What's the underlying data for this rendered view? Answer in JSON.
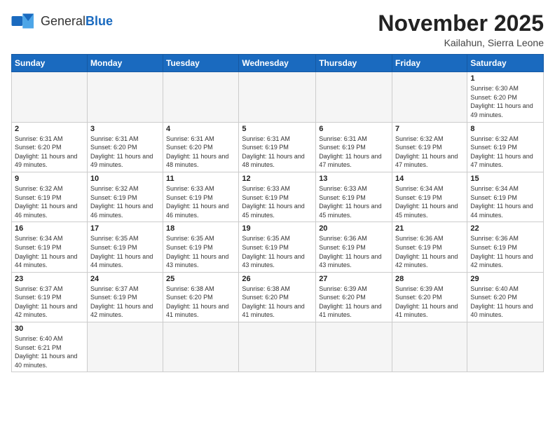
{
  "logo": {
    "general": "General",
    "blue": "Blue"
  },
  "title": "November 2025",
  "location": "Kailahun, Sierra Leone",
  "days_of_week": [
    "Sunday",
    "Monday",
    "Tuesday",
    "Wednesday",
    "Thursday",
    "Friday",
    "Saturday"
  ],
  "weeks": [
    [
      {
        "day": "",
        "info": ""
      },
      {
        "day": "",
        "info": ""
      },
      {
        "day": "",
        "info": ""
      },
      {
        "day": "",
        "info": ""
      },
      {
        "day": "",
        "info": ""
      },
      {
        "day": "",
        "info": ""
      },
      {
        "day": "1",
        "info": "Sunrise: 6:30 AM\nSunset: 6:20 PM\nDaylight: 11 hours and 49 minutes."
      }
    ],
    [
      {
        "day": "2",
        "info": "Sunrise: 6:31 AM\nSunset: 6:20 PM\nDaylight: 11 hours and 49 minutes."
      },
      {
        "day": "3",
        "info": "Sunrise: 6:31 AM\nSunset: 6:20 PM\nDaylight: 11 hours and 49 minutes."
      },
      {
        "day": "4",
        "info": "Sunrise: 6:31 AM\nSunset: 6:20 PM\nDaylight: 11 hours and 48 minutes."
      },
      {
        "day": "5",
        "info": "Sunrise: 6:31 AM\nSunset: 6:19 PM\nDaylight: 11 hours and 48 minutes."
      },
      {
        "day": "6",
        "info": "Sunrise: 6:31 AM\nSunset: 6:19 PM\nDaylight: 11 hours and 47 minutes."
      },
      {
        "day": "7",
        "info": "Sunrise: 6:32 AM\nSunset: 6:19 PM\nDaylight: 11 hours and 47 minutes."
      },
      {
        "day": "8",
        "info": "Sunrise: 6:32 AM\nSunset: 6:19 PM\nDaylight: 11 hours and 47 minutes."
      }
    ],
    [
      {
        "day": "9",
        "info": "Sunrise: 6:32 AM\nSunset: 6:19 PM\nDaylight: 11 hours and 46 minutes."
      },
      {
        "day": "10",
        "info": "Sunrise: 6:32 AM\nSunset: 6:19 PM\nDaylight: 11 hours and 46 minutes."
      },
      {
        "day": "11",
        "info": "Sunrise: 6:33 AM\nSunset: 6:19 PM\nDaylight: 11 hours and 46 minutes."
      },
      {
        "day": "12",
        "info": "Sunrise: 6:33 AM\nSunset: 6:19 PM\nDaylight: 11 hours and 45 minutes."
      },
      {
        "day": "13",
        "info": "Sunrise: 6:33 AM\nSunset: 6:19 PM\nDaylight: 11 hours and 45 minutes."
      },
      {
        "day": "14",
        "info": "Sunrise: 6:34 AM\nSunset: 6:19 PM\nDaylight: 11 hours and 45 minutes."
      },
      {
        "day": "15",
        "info": "Sunrise: 6:34 AM\nSunset: 6:19 PM\nDaylight: 11 hours and 44 minutes."
      }
    ],
    [
      {
        "day": "16",
        "info": "Sunrise: 6:34 AM\nSunset: 6:19 PM\nDaylight: 11 hours and 44 minutes."
      },
      {
        "day": "17",
        "info": "Sunrise: 6:35 AM\nSunset: 6:19 PM\nDaylight: 11 hours and 44 minutes."
      },
      {
        "day": "18",
        "info": "Sunrise: 6:35 AM\nSunset: 6:19 PM\nDaylight: 11 hours and 43 minutes."
      },
      {
        "day": "19",
        "info": "Sunrise: 6:35 AM\nSunset: 6:19 PM\nDaylight: 11 hours and 43 minutes."
      },
      {
        "day": "20",
        "info": "Sunrise: 6:36 AM\nSunset: 6:19 PM\nDaylight: 11 hours and 43 minutes."
      },
      {
        "day": "21",
        "info": "Sunrise: 6:36 AM\nSunset: 6:19 PM\nDaylight: 11 hours and 42 minutes."
      },
      {
        "day": "22",
        "info": "Sunrise: 6:36 AM\nSunset: 6:19 PM\nDaylight: 11 hours and 42 minutes."
      }
    ],
    [
      {
        "day": "23",
        "info": "Sunrise: 6:37 AM\nSunset: 6:19 PM\nDaylight: 11 hours and 42 minutes."
      },
      {
        "day": "24",
        "info": "Sunrise: 6:37 AM\nSunset: 6:19 PM\nDaylight: 11 hours and 42 minutes."
      },
      {
        "day": "25",
        "info": "Sunrise: 6:38 AM\nSunset: 6:20 PM\nDaylight: 11 hours and 41 minutes."
      },
      {
        "day": "26",
        "info": "Sunrise: 6:38 AM\nSunset: 6:20 PM\nDaylight: 11 hours and 41 minutes."
      },
      {
        "day": "27",
        "info": "Sunrise: 6:39 AM\nSunset: 6:20 PM\nDaylight: 11 hours and 41 minutes."
      },
      {
        "day": "28",
        "info": "Sunrise: 6:39 AM\nSunset: 6:20 PM\nDaylight: 11 hours and 41 minutes."
      },
      {
        "day": "29",
        "info": "Sunrise: 6:40 AM\nSunset: 6:20 PM\nDaylight: 11 hours and 40 minutes."
      }
    ],
    [
      {
        "day": "30",
        "info": "Sunrise: 6:40 AM\nSunset: 6:21 PM\nDaylight: 11 hours and 40 minutes."
      },
      {
        "day": "",
        "info": ""
      },
      {
        "day": "",
        "info": ""
      },
      {
        "day": "",
        "info": ""
      },
      {
        "day": "",
        "info": ""
      },
      {
        "day": "",
        "info": ""
      },
      {
        "day": "",
        "info": ""
      }
    ]
  ]
}
